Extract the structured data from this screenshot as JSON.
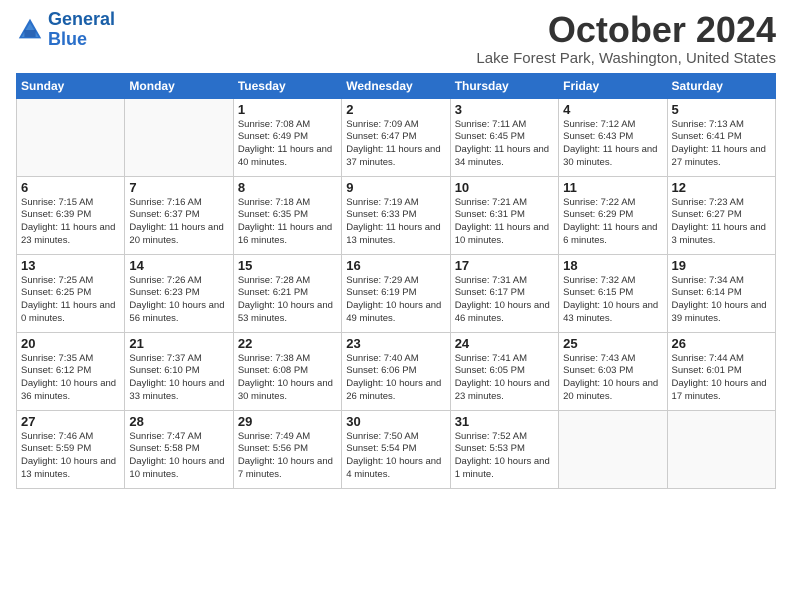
{
  "header": {
    "logo_line1": "General",
    "logo_line2": "Blue",
    "month": "October 2024",
    "location": "Lake Forest Park, Washington, United States"
  },
  "days_of_week": [
    "Sunday",
    "Monday",
    "Tuesday",
    "Wednesday",
    "Thursday",
    "Friday",
    "Saturday"
  ],
  "weeks": [
    [
      {
        "day": "",
        "info": ""
      },
      {
        "day": "",
        "info": ""
      },
      {
        "day": "1",
        "info": "Sunrise: 7:08 AM\nSunset: 6:49 PM\nDaylight: 11 hours and 40 minutes."
      },
      {
        "day": "2",
        "info": "Sunrise: 7:09 AM\nSunset: 6:47 PM\nDaylight: 11 hours and 37 minutes."
      },
      {
        "day": "3",
        "info": "Sunrise: 7:11 AM\nSunset: 6:45 PM\nDaylight: 11 hours and 34 minutes."
      },
      {
        "day": "4",
        "info": "Sunrise: 7:12 AM\nSunset: 6:43 PM\nDaylight: 11 hours and 30 minutes."
      },
      {
        "day": "5",
        "info": "Sunrise: 7:13 AM\nSunset: 6:41 PM\nDaylight: 11 hours and 27 minutes."
      }
    ],
    [
      {
        "day": "6",
        "info": "Sunrise: 7:15 AM\nSunset: 6:39 PM\nDaylight: 11 hours and 23 minutes."
      },
      {
        "day": "7",
        "info": "Sunrise: 7:16 AM\nSunset: 6:37 PM\nDaylight: 11 hours and 20 minutes."
      },
      {
        "day": "8",
        "info": "Sunrise: 7:18 AM\nSunset: 6:35 PM\nDaylight: 11 hours and 16 minutes."
      },
      {
        "day": "9",
        "info": "Sunrise: 7:19 AM\nSunset: 6:33 PM\nDaylight: 11 hours and 13 minutes."
      },
      {
        "day": "10",
        "info": "Sunrise: 7:21 AM\nSunset: 6:31 PM\nDaylight: 11 hours and 10 minutes."
      },
      {
        "day": "11",
        "info": "Sunrise: 7:22 AM\nSunset: 6:29 PM\nDaylight: 11 hours and 6 minutes."
      },
      {
        "day": "12",
        "info": "Sunrise: 7:23 AM\nSunset: 6:27 PM\nDaylight: 11 hours and 3 minutes."
      }
    ],
    [
      {
        "day": "13",
        "info": "Sunrise: 7:25 AM\nSunset: 6:25 PM\nDaylight: 11 hours and 0 minutes."
      },
      {
        "day": "14",
        "info": "Sunrise: 7:26 AM\nSunset: 6:23 PM\nDaylight: 10 hours and 56 minutes."
      },
      {
        "day": "15",
        "info": "Sunrise: 7:28 AM\nSunset: 6:21 PM\nDaylight: 10 hours and 53 minutes."
      },
      {
        "day": "16",
        "info": "Sunrise: 7:29 AM\nSunset: 6:19 PM\nDaylight: 10 hours and 49 minutes."
      },
      {
        "day": "17",
        "info": "Sunrise: 7:31 AM\nSunset: 6:17 PM\nDaylight: 10 hours and 46 minutes."
      },
      {
        "day": "18",
        "info": "Sunrise: 7:32 AM\nSunset: 6:15 PM\nDaylight: 10 hours and 43 minutes."
      },
      {
        "day": "19",
        "info": "Sunrise: 7:34 AM\nSunset: 6:14 PM\nDaylight: 10 hours and 39 minutes."
      }
    ],
    [
      {
        "day": "20",
        "info": "Sunrise: 7:35 AM\nSunset: 6:12 PM\nDaylight: 10 hours and 36 minutes."
      },
      {
        "day": "21",
        "info": "Sunrise: 7:37 AM\nSunset: 6:10 PM\nDaylight: 10 hours and 33 minutes."
      },
      {
        "day": "22",
        "info": "Sunrise: 7:38 AM\nSunset: 6:08 PM\nDaylight: 10 hours and 30 minutes."
      },
      {
        "day": "23",
        "info": "Sunrise: 7:40 AM\nSunset: 6:06 PM\nDaylight: 10 hours and 26 minutes."
      },
      {
        "day": "24",
        "info": "Sunrise: 7:41 AM\nSunset: 6:05 PM\nDaylight: 10 hours and 23 minutes."
      },
      {
        "day": "25",
        "info": "Sunrise: 7:43 AM\nSunset: 6:03 PM\nDaylight: 10 hours and 20 minutes."
      },
      {
        "day": "26",
        "info": "Sunrise: 7:44 AM\nSunset: 6:01 PM\nDaylight: 10 hours and 17 minutes."
      }
    ],
    [
      {
        "day": "27",
        "info": "Sunrise: 7:46 AM\nSunset: 5:59 PM\nDaylight: 10 hours and 13 minutes."
      },
      {
        "day": "28",
        "info": "Sunrise: 7:47 AM\nSunset: 5:58 PM\nDaylight: 10 hours and 10 minutes."
      },
      {
        "day": "29",
        "info": "Sunrise: 7:49 AM\nSunset: 5:56 PM\nDaylight: 10 hours and 7 minutes."
      },
      {
        "day": "30",
        "info": "Sunrise: 7:50 AM\nSunset: 5:54 PM\nDaylight: 10 hours and 4 minutes."
      },
      {
        "day": "31",
        "info": "Sunrise: 7:52 AM\nSunset: 5:53 PM\nDaylight: 10 hours and 1 minute."
      },
      {
        "day": "",
        "info": ""
      },
      {
        "day": "",
        "info": ""
      }
    ]
  ]
}
